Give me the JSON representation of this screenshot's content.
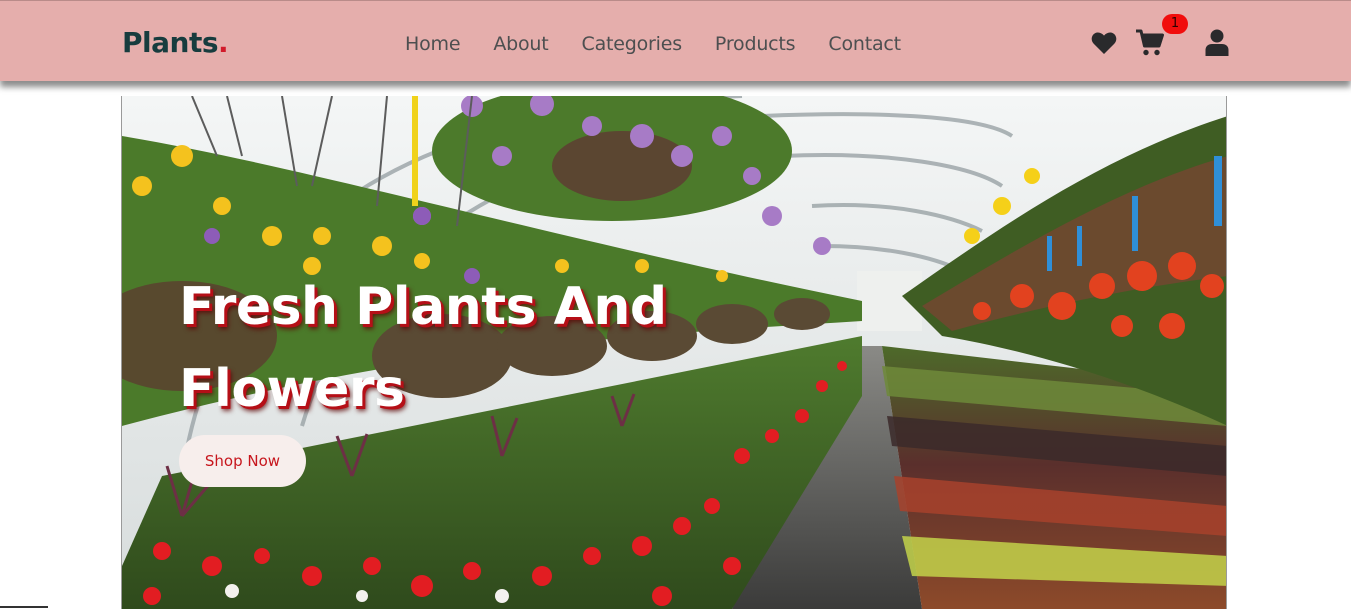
{
  "brand": {
    "name": "Plants",
    "dot": "."
  },
  "nav": {
    "links": [
      "Home",
      "About",
      "Categories",
      "Products",
      "Contact"
    ]
  },
  "icons": {
    "wishlist": "heart-icon",
    "cart": "cart-icon",
    "account": "user-icon"
  },
  "cart": {
    "count": "1"
  },
  "hero": {
    "title_line1": "Fresh Plants And",
    "title_line2": "Flowers",
    "cta": "Shop Now"
  },
  "colors": {
    "navbar": "#e5aeac",
    "logo": "#173c3e",
    "accent": "#c7161d",
    "badge": "#f10d0d"
  }
}
